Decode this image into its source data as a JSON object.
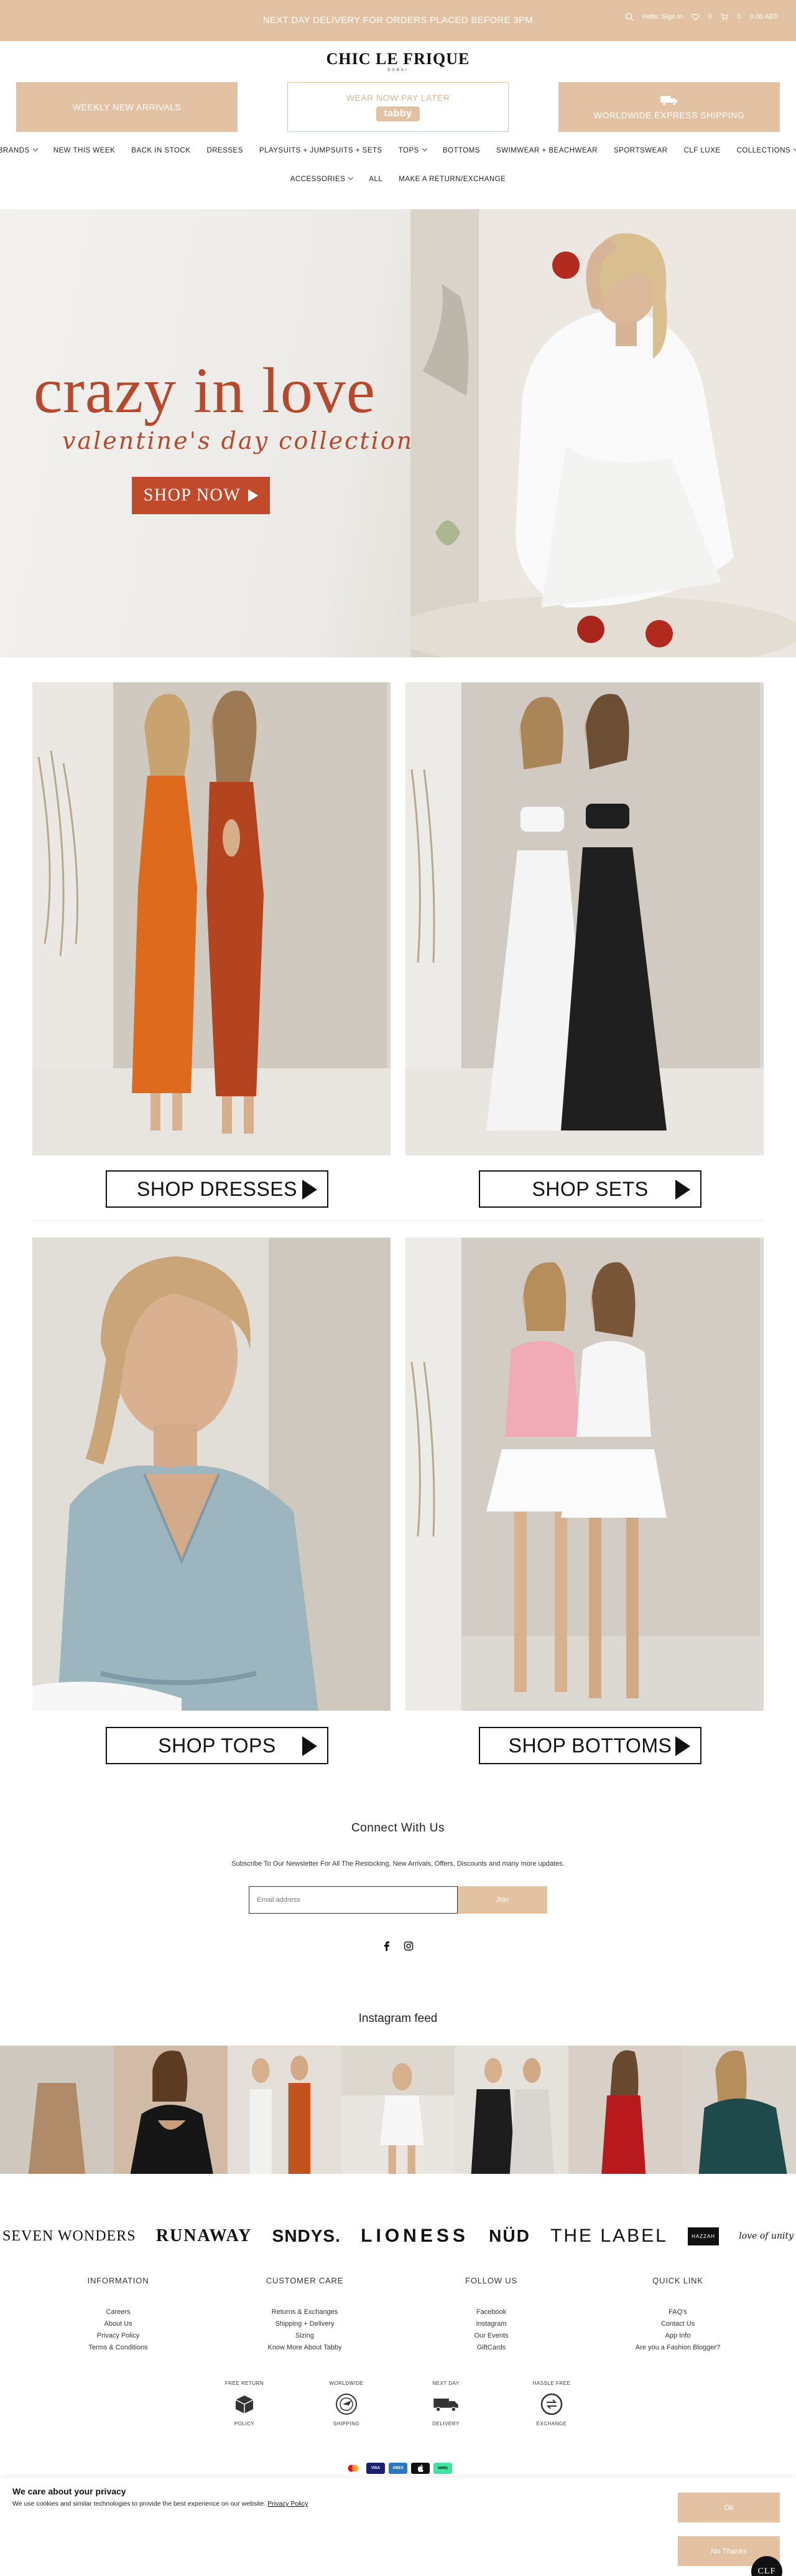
{
  "topbar": {
    "promo": "NEXT DAY DELIVERY FOR ORDERS PLACED BEFORE 3PM",
    "account_label": "Hello: Sign In",
    "wishlist_count": "0",
    "cart_count": "0",
    "cart_total": "0.00 AED"
  },
  "header": {
    "logo_main": "CHIC LE FRIQUE",
    "logo_sub": "DUBAI",
    "left_box": "WEEKLY NEW ARRIVALS",
    "mid_box": "WEAR NOW PAY LATER",
    "tabby_label": "tabby",
    "right_box": "WORLDWIDE EXPRESS SHIPPING"
  },
  "nav": {
    "row1": [
      "BRANDS",
      "NEW THIS WEEK",
      "BACK IN STOCK",
      "DRESSES",
      "PLAYSUITS + JUMPSUITS + SETS",
      "TOPS",
      "BOTTOMS",
      "SWIMWEAR + BEACHWEAR",
      "SPORTSWEAR",
      "CLF LUXE",
      "COLLECTIONS"
    ],
    "row2": [
      "ACCESSORIES",
      "ALL",
      "MAKE A RETURN/EXCHANGE"
    ]
  },
  "hero": {
    "title": "crazy in love",
    "subtitle": "valentine's day collection",
    "button": "SHOP NOW"
  },
  "tiles": {
    "dresses": "SHOP DRESSES",
    "sets": "SHOP SETS",
    "tops": "SHOP TOPS",
    "bottoms": "SHOP BOTTOMS"
  },
  "connect": {
    "title": "Connect With Us",
    "text": "Subscribe To Our Newsletter For All The Restocking, New Arrivals, Offers, Discounts and many more updates.",
    "email_placeholder": "Email address",
    "join": "Join"
  },
  "instagram": {
    "title": "Instagram feed"
  },
  "brands": [
    "SEVEN WONDERS",
    "RUNAWAY",
    "SNDYS.",
    "LIONESS",
    "NÜD",
    "THE LABEL",
    "HAZZAH",
    "love of unity"
  ],
  "footer": {
    "information": {
      "title": "INFORMATION",
      "links": [
        "Careers",
        "About Us",
        "Privacy Policy",
        "Terms & Conditions"
      ]
    },
    "customer_care": {
      "title": "CUSTOMER CARE",
      "links": [
        "Returns & Exchanges",
        "Shipping + Delivery",
        "Sizing",
        "Know More About Tabby"
      ]
    },
    "follow_us": {
      "title": "FOLLOW US",
      "links": [
        "Facebook",
        "Instagram",
        "Our Events",
        "GiftCards"
      ]
    },
    "quick_link": {
      "title": "QUICK LINK",
      "links": [
        "FAQ's",
        "Contact Us",
        "App Info",
        "Are you a Fashion Blogger?"
      ]
    }
  },
  "features": [
    {
      "top": "FREE RETURN",
      "bottom": "POLICY"
    },
    {
      "top": "WORLDWIDE",
      "bottom": "SHIPPING"
    },
    {
      "top": "NEXT DAY",
      "bottom": "DELIVERY"
    },
    {
      "top": "HASSLE FREE",
      "bottom": "EXCHANGE"
    }
  ],
  "payments": [
    "MC",
    "VISA",
    "AMEX",
    "Apple Pay",
    "tabby"
  ],
  "cookie": {
    "title": "We care about your privacy",
    "text": "We use cookies and similar technologies to provide the best experience on our website.",
    "link": "Privacy Policy",
    "ok": "Ok",
    "no_thanks": "No Thanks"
  },
  "badge": "CLF",
  "colors": {
    "accent": "#e3c2a3",
    "hero_red": "#c14a2d"
  }
}
